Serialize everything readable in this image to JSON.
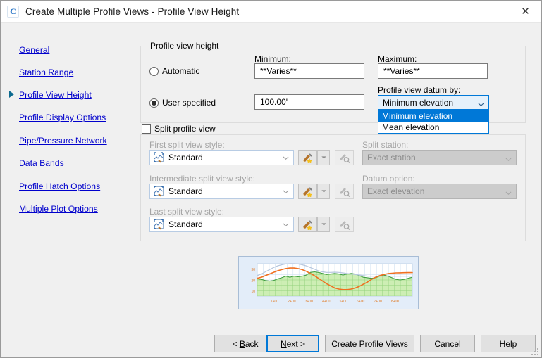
{
  "window": {
    "title": "Create Multiple Profile Views - Profile View Height",
    "app_icon": "civil3d-c-icon",
    "close_label": "✕"
  },
  "sidebar": {
    "items": [
      {
        "label": "General",
        "current": false
      },
      {
        "label": "Station Range",
        "current": false
      },
      {
        "label": "Profile View Height",
        "current": true
      },
      {
        "label": "Profile Display Options",
        "current": false
      },
      {
        "label": "Pipe/Pressure Network",
        "current": false
      },
      {
        "label": "Data Bands",
        "current": false
      },
      {
        "label": "Profile Hatch Options",
        "current": false
      },
      {
        "label": "Multiple Plot Options",
        "current": false
      }
    ]
  },
  "height_group": {
    "title": "Profile view height",
    "automatic_label": "Automatic",
    "automatic_checked": false,
    "user_specified_label": "User specified",
    "user_specified_checked": true,
    "minimum_label": "Minimum:",
    "minimum_value": "**Varies**",
    "maximum_label": "Maximum:",
    "maximum_value": "**Varies**",
    "height_value": "100.00'",
    "datum_label": "Profile view datum by:",
    "datum_value": "Minimum elevation",
    "datum_options": [
      {
        "label": "Minimum elevation",
        "selected": true
      },
      {
        "label": "Mean elevation",
        "selected": false
      }
    ]
  },
  "split_group": {
    "checkbox_label": "Split profile view",
    "checked": false,
    "first_style_label": "First split view style:",
    "first_style_value": "Standard",
    "intermediate_style_label": "Intermediate split view style:",
    "intermediate_style_value": "Standard",
    "last_style_label": "Last split view style:",
    "last_style_value": "Standard",
    "split_station_label": "Split station:",
    "split_station_value": "Exact station",
    "datum_option_label": "Datum option:",
    "datum_option_value": "Exact elevation",
    "edit_icon": "edit-style-brush-icon",
    "dropdown_icon": "chevron-down-icon",
    "preview_icon": "preview-style-magnifier-icon"
  },
  "preview": {
    "name": "profile-view-preview"
  },
  "chart_data": {
    "type": "area",
    "title": "",
    "xlabel": "",
    "ylabel": "",
    "xticks": [
      "1+00",
      "2+00",
      "3+00",
      "4+00",
      "5+00",
      "6+00",
      "7+00",
      "8+00"
    ],
    "yticks": [
      "10",
      "20",
      "30"
    ],
    "ylim": [
      5,
      35
    ],
    "grid": true,
    "series": [
      {
        "name": "existing-ground-terrain",
        "type": "area",
        "color": "#3f9e3f",
        "fill": "#cdeeb4",
        "values": [
          21,
          20.5,
          19.5,
          19,
          19.5,
          21,
          22,
          23.5,
          22.5,
          23.5,
          23,
          23.5,
          24.5,
          27,
          27.5,
          27,
          26,
          25,
          25.5,
          26,
          25.5,
          24.5,
          25.5,
          26,
          25.5,
          24,
          22.5,
          22,
          21.5,
          22,
          23.5,
          24.5,
          23.5,
          22,
          20.5,
          20,
          20.5,
          21.5,
          22.5
        ]
      },
      {
        "name": "design-profile",
        "type": "line",
        "color": "#f07020",
        "values": [
          21.5,
          22.5,
          24,
          25.5,
          27,
          28.5,
          29.5,
          30.5,
          31,
          31,
          30.5,
          29.5,
          28,
          26,
          24,
          21.5,
          19,
          16.5,
          14.5,
          12.5,
          11.5,
          11,
          11,
          11.5,
          12.5,
          14,
          16,
          18,
          20.5,
          22.5,
          24,
          25,
          25.8,
          26.2,
          26.5,
          26.6,
          26.7,
          26.8,
          26.8
        ]
      },
      {
        "name": "secondary-profile",
        "type": "line",
        "color": "#b6c6dd",
        "values": [
          24,
          25.5,
          27.5,
          29.5,
          31.5,
          33,
          34,
          34.8,
          35,
          35,
          34.8,
          34,
          33,
          31.5,
          30,
          28.5,
          27.5,
          27,
          27,
          27.2,
          27,
          26.5,
          26,
          25.5,
          25,
          24.5,
          24,
          23.5,
          23.5,
          23.5,
          23.5,
          23.5,
          23.5,
          23.5,
          23.5,
          23.5,
          23.5,
          23.5,
          23.5
        ]
      }
    ]
  },
  "footer": {
    "back_label": "< Back",
    "back_accel": "B",
    "next_label": "Next >",
    "next_accel": "N",
    "create_label": "Create Profile Views",
    "cancel_label": "Cancel",
    "help_label": "Help"
  }
}
